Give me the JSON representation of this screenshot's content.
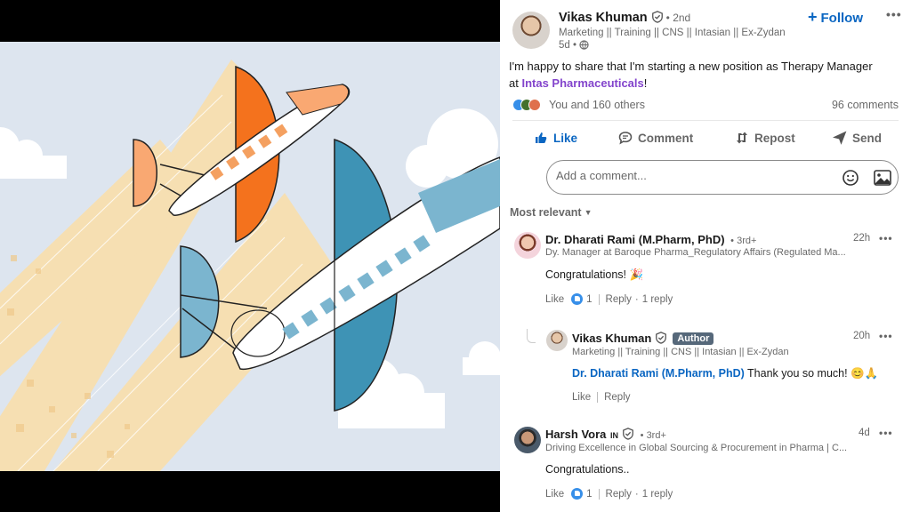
{
  "post": {
    "author": {
      "name": "Vikas Khuman",
      "degree": "• 2nd",
      "headline": "Marketing || Training || CNS || Intasian || Ex-Zydan",
      "time": "5d •"
    },
    "follow_label": "Follow",
    "more_label": "•••",
    "text_before": "I'm happy to share that I'm starting a new position as Therapy Manager at ",
    "mention": "Intas Pharmaceuticals",
    "text_after": "!",
    "reactions_text": "You and 160 others",
    "comments_count": "96 comments",
    "reaction_colors": [
      "#378fe9",
      "#44712e",
      "#df704d"
    ]
  },
  "actions": {
    "like": "Like",
    "comment": "Comment",
    "repost": "Repost",
    "send": "Send"
  },
  "comment_box": {
    "placeholder": "Add a comment..."
  },
  "sort_label": "Most relevant",
  "comments": [
    {
      "name": "Dr. Dharati Rami (M.Pharm, PhD)",
      "degree": "• 3rd+",
      "headline": "Dy. Manager at Baroque Pharma_Regulatory Affairs (Regulated Ma...",
      "time": "22h",
      "body": "Congratulations! 🎉",
      "like_label": "Like",
      "like_count": "1",
      "reply_label": "Reply",
      "reply_count": "1 reply"
    },
    {
      "name": "Vikas Khuman",
      "badge": "Author",
      "headline": "Marketing || Training || CNS || Intasian || Ex-Zydan",
      "time": "20h",
      "mention": "Dr. Dharati Rami (M.Pharm, PhD)",
      "body": " Thank you so much! 😊🙏",
      "like_label": "Like",
      "reply_label": "Reply"
    },
    {
      "name": "Harsh Vora",
      "name_suffix": "IN",
      "degree": "• 3rd+",
      "headline": "Driving Excellence in Global Sourcing & Procurement in Pharma | C...",
      "time": "4d",
      "body": "Congratulations..",
      "like_label": "Like",
      "like_count": "1",
      "reply_label": "Reply",
      "reply_count": "1 reply"
    }
  ],
  "colors": {
    "accent": "#0a66c2",
    "mention_company": "#8344cc",
    "sky": "#dde5ef",
    "trail": "#f6dfb2",
    "orange": "#f4721d",
    "peach": "#f9a872",
    "teal": "#3e93b5",
    "light_teal": "#7bb5cf"
  }
}
